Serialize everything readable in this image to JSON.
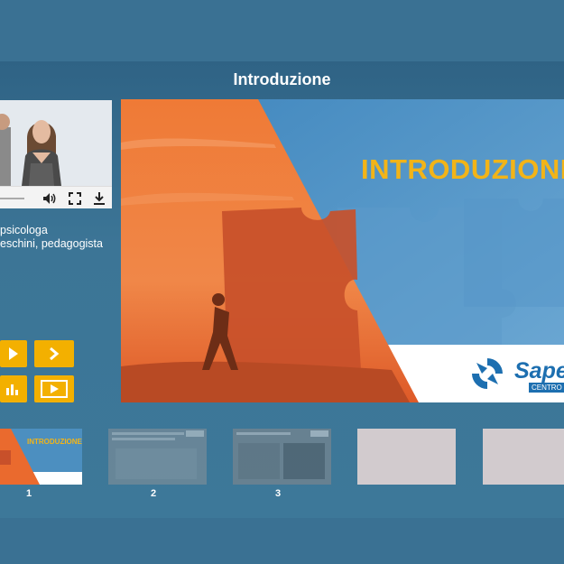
{
  "lesson": {
    "title": "Introduzione"
  },
  "speaker": {
    "line1": "psicologa",
    "line2": "eschini, pedagogista"
  },
  "video": {
    "progress": 0.22,
    "icons": [
      "volume-icon",
      "fullscreen-icon",
      "download-icon"
    ]
  },
  "navigation": {
    "prev_icon": "play-icon",
    "next_icon": "chevron-right-icon",
    "menu_icon": "bars-chart-icon",
    "video_icon": "video-play-icon"
  },
  "slide": {
    "heading": "INTRODUZIONE",
    "brand": "Sape",
    "brand_sub": "CENTRO S"
  },
  "thumbnails": [
    {
      "number": "1",
      "heading": "INTRODUZIONE",
      "state": "current"
    },
    {
      "number": "2",
      "state": "visited"
    },
    {
      "number": "3",
      "state": "visited"
    },
    {
      "number": "",
      "state": "empty"
    },
    {
      "number": "",
      "state": "empty"
    }
  ],
  "colors": {
    "background": "#3f7698",
    "accent_orange": "#f3b000",
    "slide_orange": "#ea6a2e",
    "slide_blue": "#4c8fc0",
    "brand_blue": "#1d6fb0"
  }
}
